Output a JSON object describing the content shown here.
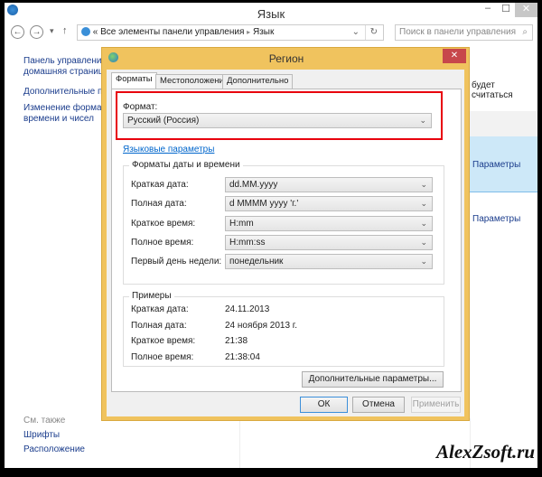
{
  "window": {
    "title": "Язык",
    "minimize": "–",
    "maximize": "☐",
    "close": "✕"
  },
  "address": {
    "back": "←",
    "forward": "→",
    "recent": "▾",
    "up": "↑",
    "prefix": "«",
    "crumb1": "Все элементы панели управления",
    "sep": "▸",
    "crumb2": "Язык",
    "dropdown": "⌄",
    "refresh": "↻"
  },
  "search": {
    "placeholder": "Поиск в панели управления",
    "icon": "⌕"
  },
  "sidebar": {
    "items": [
      "Панель управления -",
      "домашняя страница",
      "Дополнительные пар",
      "Изменение формато",
      "времени и чисел"
    ],
    "see_also": "См. также",
    "links": [
      "Шрифты",
      "Расположение"
    ]
  },
  "main": {
    "partial_text": "будет считаться",
    "params1": "Параметры",
    "params2": "Параметры"
  },
  "dialog": {
    "title": "Регион",
    "close": "✕",
    "tabs": [
      "Форматы",
      "Местоположение",
      "Дополнительно"
    ],
    "format_label": "Формат:",
    "format_value": "Русский (Россия)",
    "lang_link": "Языковые параметры",
    "dt_group": "Форматы даты и времени",
    "dt_rows": [
      {
        "label": "Краткая дата:",
        "value": "dd.MM.yyyy"
      },
      {
        "label": "Полная дата:",
        "value": "d MMMM yyyy 'г.'"
      },
      {
        "label": "Краткое время:",
        "value": "H:mm"
      },
      {
        "label": "Полное время:",
        "value": "H:mm:ss"
      },
      {
        "label": "Первый день недели:",
        "value": "понедельник"
      }
    ],
    "ex_group": "Примеры",
    "ex_rows": [
      {
        "label": "Краткая дата:",
        "value": "24.11.2013"
      },
      {
        "label": "Полная дата:",
        "value": "24 ноября 2013 г."
      },
      {
        "label": "Краткое время:",
        "value": "21:38"
      },
      {
        "label": "Полное время:",
        "value": "21:38:04"
      }
    ],
    "advanced": "Дополнительные параметры...",
    "ok": "ОК",
    "cancel": "Отмена",
    "apply": "Применить",
    "chevron": "⌄"
  },
  "watermark": "AlexZsoft.ru"
}
